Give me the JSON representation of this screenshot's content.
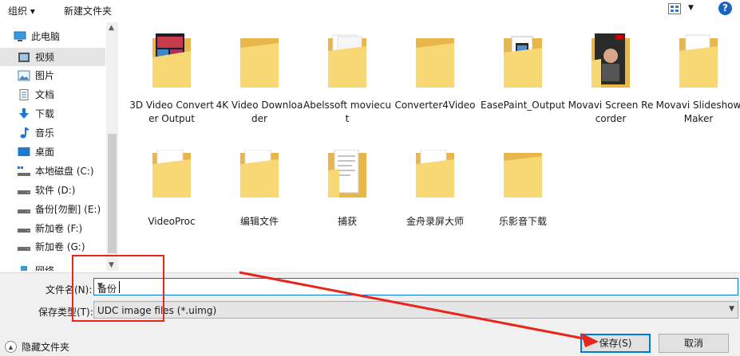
{
  "toolbar": {
    "organize_label": "组织 ▾",
    "new_folder_label": "新建文件夹",
    "help_glyph": "?"
  },
  "nav": {
    "items": [
      {
        "label": "此电脑",
        "icon": "computer-icon"
      },
      {
        "label": "视频",
        "icon": "video-icon",
        "selected": true
      },
      {
        "label": "图片",
        "icon": "pictures-icon"
      },
      {
        "label": "文档",
        "icon": "documents-icon"
      },
      {
        "label": "下载",
        "icon": "download-icon"
      },
      {
        "label": "音乐",
        "icon": "music-icon"
      },
      {
        "label": "桌面",
        "icon": "desktop-icon"
      },
      {
        "label": "本地磁盘 (C:)",
        "icon": "drive-c-icon"
      },
      {
        "label": "软件 (D:)",
        "icon": "drive-icon"
      },
      {
        "label": "备份[勿删] (E:)",
        "icon": "drive-icon"
      },
      {
        "label": "新加卷 (F:)",
        "icon": "drive-icon"
      },
      {
        "label": "新加卷 (G:)",
        "icon": "drive-icon"
      },
      {
        "label": "网络",
        "icon": "network-icon"
      }
    ]
  },
  "files": [
    {
      "name": "3D Video Converter Output",
      "thumb": "video-collage"
    },
    {
      "name": "4K Video Downloader",
      "thumb": "plain"
    },
    {
      "name": "Abelssoft moviecut",
      "thumb": "papers"
    },
    {
      "name": "Converter4Video",
      "thumb": "plain"
    },
    {
      "name": "EasePaint_Output",
      "thumb": "phone-image"
    },
    {
      "name": "Movavi Screen Recorder",
      "thumb": "person-photo"
    },
    {
      "name": "Movavi Slideshow Maker",
      "thumb": "papers"
    },
    {
      "name": "VideoProc",
      "thumb": "papers"
    },
    {
      "name": "编辑文件",
      "thumb": "papers"
    },
    {
      "name": "捕获",
      "thumb": "document-page"
    },
    {
      "name": "金舟录屏大师",
      "thumb": "papers"
    },
    {
      "name": "乐影音下载",
      "thumb": "plain"
    }
  ],
  "form": {
    "filename_label": "文件名(N):",
    "filename_value": "备份",
    "filetype_label": "保存类型(T):",
    "filetype_value": "UDC image files (*.uimg)"
  },
  "footer": {
    "hide_folders_label": "隐藏文件夹",
    "save_label": "保存(S)",
    "cancel_label": "取消"
  },
  "colors": {
    "folder_back": "#e8b64a",
    "folder_front": "#f8d775",
    "accent": "#0078d7",
    "annotation": "#e8261c"
  }
}
